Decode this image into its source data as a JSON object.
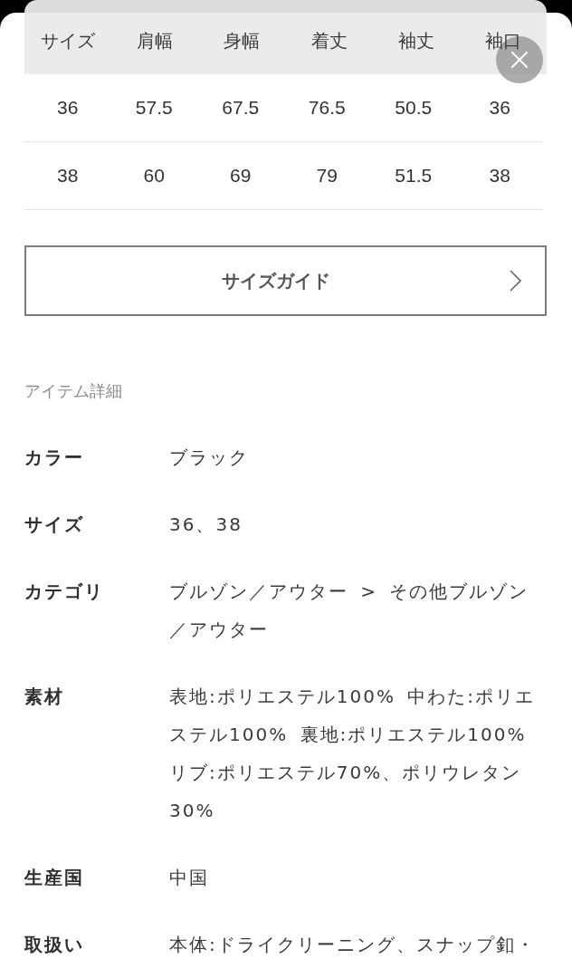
{
  "size_table": {
    "columns": [
      "サイズ",
      "肩幅",
      "身幅",
      "着丈",
      "袖丈",
      "袖口"
    ],
    "rows": [
      [
        "36",
        "57.5",
        "67.5",
        "76.5",
        "50.5",
        "36"
      ],
      [
        "38",
        "60",
        "69",
        "79",
        "51.5",
        "38"
      ]
    ]
  },
  "size_guide_button": {
    "label": "サイズガイド"
  },
  "item_details": {
    "title": "アイテム詳細",
    "rows": [
      {
        "label": "カラー",
        "value": "ブラック"
      },
      {
        "label": "サイズ",
        "value": "36、38"
      },
      {
        "label": "カテゴリ",
        "value": "ブルゾン／アウター > その他ブルゾン／アウター"
      },
      {
        "label": "素材",
        "value": "表地:ポリエステル100% 中わた:ポリエステル100% 裏地:ポリエステル100% リブ:ポリエステル70%、ポリウレタン30%"
      },
      {
        "label": "生産国",
        "value": "中国"
      },
      {
        "label": "取扱い",
        "value": "本体:ドライクリーニング、スナップ釦・"
      }
    ]
  }
}
